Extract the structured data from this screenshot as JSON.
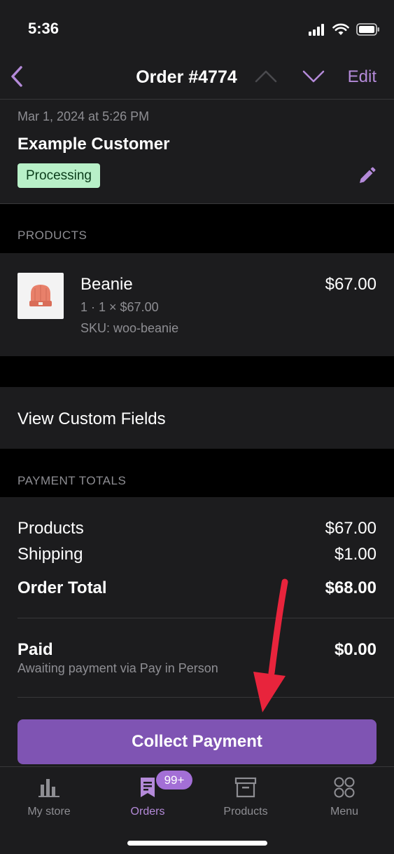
{
  "status_bar": {
    "time": "5:36"
  },
  "nav": {
    "title": "Order #4774",
    "edit_label": "Edit"
  },
  "order": {
    "date": "Mar 1, 2024 at 5:26 PM",
    "customer": "Example Customer",
    "status": "Processing"
  },
  "products_section": {
    "label": "PRODUCTS",
    "items": [
      {
        "name": "Beanie",
        "quantity_line": "1 · 1 × $67.00",
        "sku": "SKU: woo-beanie",
        "price": "$67.00"
      }
    ]
  },
  "custom_fields": {
    "label": "View Custom Fields"
  },
  "totals": {
    "label": "PAYMENT TOTALS",
    "products_label": "Products",
    "products_value": "$67.00",
    "shipping_label": "Shipping",
    "shipping_value": "$1.00",
    "order_total_label": "Order Total",
    "order_total_value": "$68.00",
    "paid_label": "Paid",
    "paid_value": "$0.00",
    "paid_note": "Awaiting payment via Pay in Person",
    "collect_button": "Collect Payment"
  },
  "tab_bar": {
    "tabs": [
      {
        "label": "My store",
        "icon": "bar-chart-icon"
      },
      {
        "label": "Orders",
        "icon": "orders-icon",
        "badge": "99+"
      },
      {
        "label": "Products",
        "icon": "archive-box-icon"
      },
      {
        "label": "Menu",
        "icon": "grid-circles-icon"
      }
    ],
    "active_tab": "Orders"
  },
  "colors": {
    "accent": "#7f54b3",
    "accent_light": "#b48ad9",
    "status_badge_bg": "#b8f0c8",
    "arrow": "#e8243c",
    "background": "#1c1c1e"
  }
}
